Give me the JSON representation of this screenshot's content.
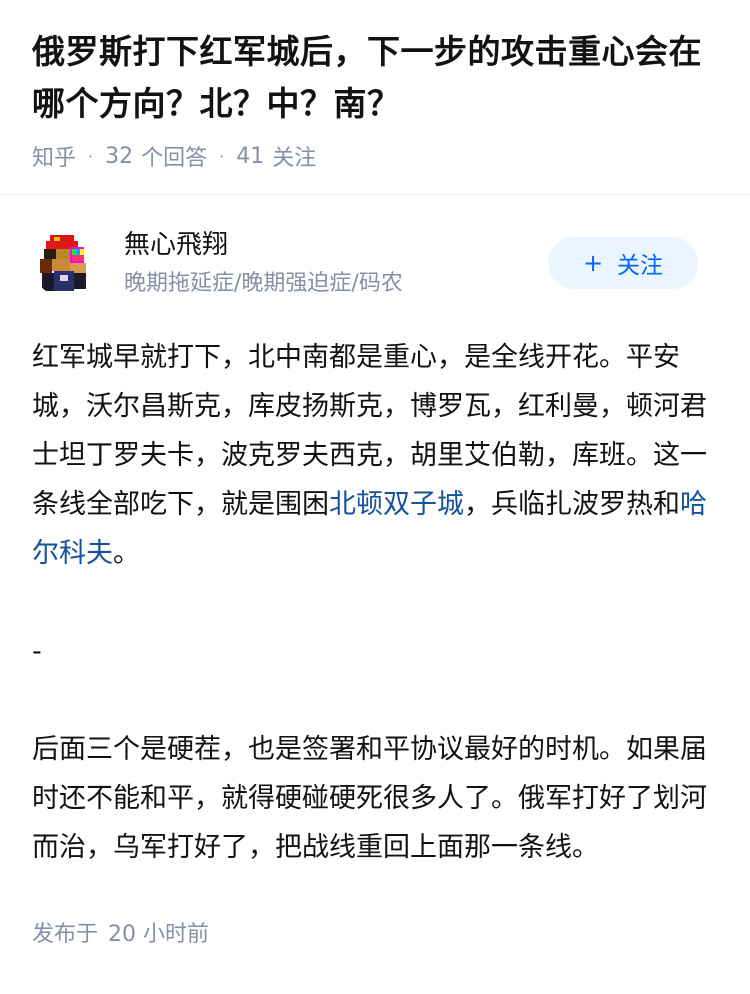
{
  "question": {
    "title": "俄罗斯打下红军城后，下一步的攻击重心会在哪个方向？北？中？南？",
    "source": "知乎",
    "answers_count": "32",
    "answers_label": "个回答",
    "followers_count": "41",
    "followers_label": "关注"
  },
  "author": {
    "name": "無心飛翔",
    "bio": "晚期拖延症/晚期强迫症/码农",
    "follow_label": "关注",
    "follow_icon": "plus-icon"
  },
  "answer": {
    "p1_text1": "红军城早就打下，北中南都是重心，是全线开花。平安城，沃尔昌斯克，库皮扬斯克，博罗瓦，红利曼，顿河君士坦丁罗夫卡，波克罗夫西克，胡里艾伯勒，库班。这一条线全部吃下，就是围困",
    "p1_link1": "北顿双子城",
    "p1_text2": "，兵临扎波罗热和",
    "p1_link2": "哈尔科夫",
    "p1_text3": "。",
    "separator": "-",
    "p2": "后面三个是硬茬，也是签署和平协议最好的时机。如果届时还不能和平，就得硬碰硬死很多人了。俄军打好了划河而治，乌军打好了，把战线重回上面那一条线。"
  },
  "footer": {
    "published_label": "发布于",
    "published_time": "20 小时前"
  },
  "colors": {
    "link": "#175199",
    "meta": "#8590a6",
    "follow_bg": "#ebf5ff",
    "follow_text": "#0066ff"
  }
}
